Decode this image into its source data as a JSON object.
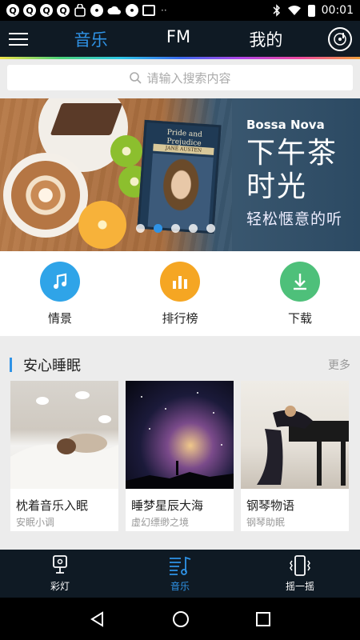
{
  "status_bar": {
    "time": "00:01",
    "notification_icons": [
      "q-icon",
      "q-icon",
      "q-icon",
      "q-icon",
      "bag-icon",
      "message-icon",
      "cloud-icon",
      "message-icon",
      "image-icon"
    ],
    "overflow": "··"
  },
  "top_nav": {
    "tabs": [
      {
        "label": "音乐",
        "active": true
      },
      {
        "label": "FM",
        "active": false
      },
      {
        "label": "我的",
        "active": false
      }
    ]
  },
  "search": {
    "placeholder": "请输入搜索内容"
  },
  "banner": {
    "title_en": "Bossa Nova",
    "title_zh_line1": "下午茶",
    "title_zh_line2": "时光",
    "subtitle": "轻松惬意的听",
    "book_title": "Pride and Prejudice",
    "book_author": "JANE AUSTEN",
    "slide_count": 5,
    "active_slide": 2
  },
  "categories": [
    {
      "label": "情景",
      "icon": "music-note-icon",
      "color": "#2fa4e8"
    },
    {
      "label": "排行榜",
      "icon": "bar-chart-icon",
      "color": "#f5a623"
    },
    {
      "label": "下载",
      "icon": "download-icon",
      "color": "#4ec07a"
    }
  ],
  "section": {
    "title": "安心睡眠",
    "more": "更多",
    "cards": [
      {
        "title": "枕着音乐入眠",
        "subtitle": "安眠小调"
      },
      {
        "title": "睡梦星辰大海",
        "subtitle": "虚幻缥缈之境"
      },
      {
        "title": "钢琴物语",
        "subtitle": "钢琴助眠"
      }
    ]
  },
  "bottom_tabs": [
    {
      "label": "彩灯",
      "icon": "lamp-icon",
      "active": false
    },
    {
      "label": "音乐",
      "icon": "music-list-icon",
      "active": true
    },
    {
      "label": "摇一摇",
      "icon": "shake-phone-icon",
      "active": false
    }
  ],
  "colors": {
    "accent": "#2f93e6",
    "nav_bg": "#0f1a24"
  }
}
